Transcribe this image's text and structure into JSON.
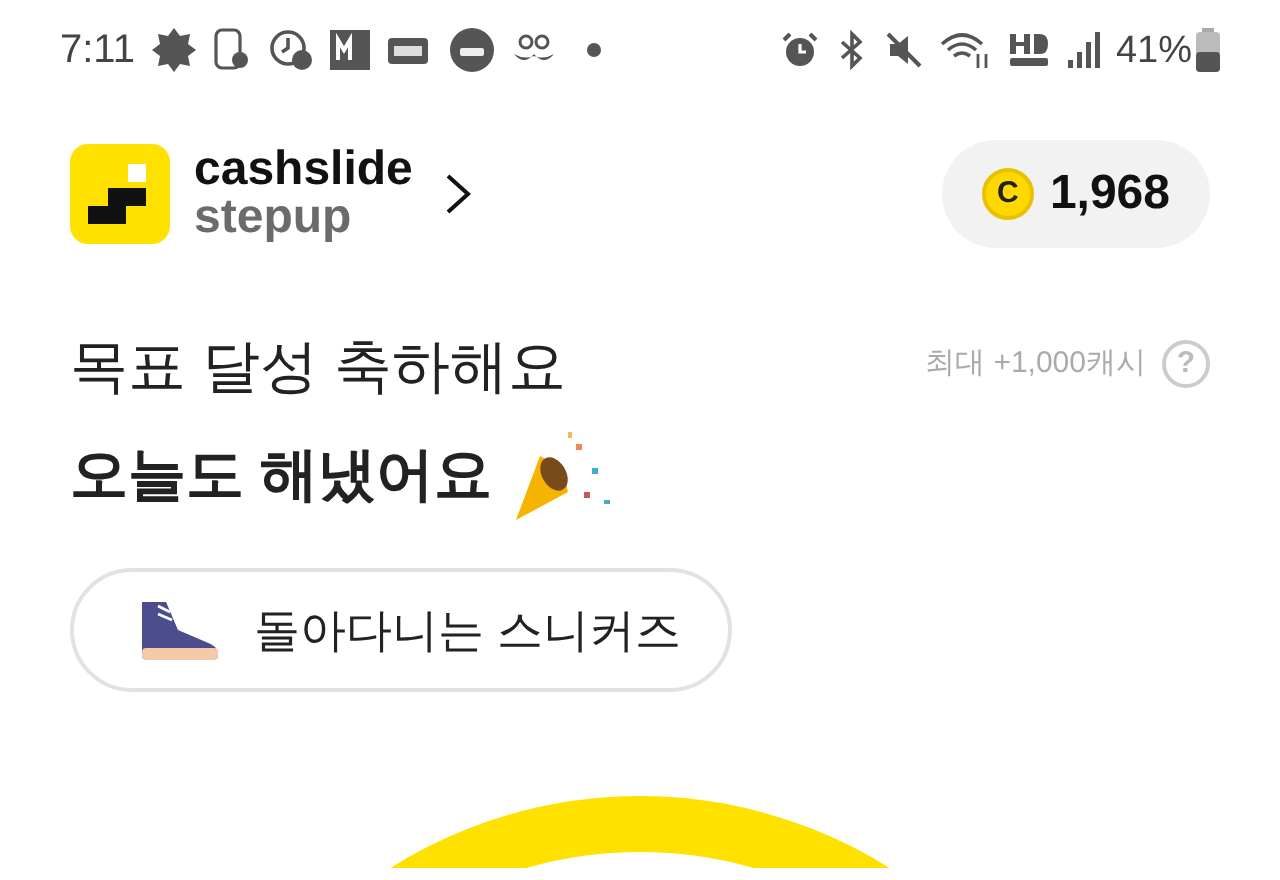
{
  "status_bar": {
    "time": "7:11",
    "battery": "41%"
  },
  "header": {
    "brand_top": "cashslide",
    "brand_bottom": "stepup",
    "coin_symbol": "C",
    "coins": "1,968"
  },
  "goal": {
    "title": "목표 달성 축하해요",
    "headline": "오늘도 해냈어요",
    "reward_note": "최대 +1,000캐시",
    "help_symbol": "?"
  },
  "item_chip": {
    "label": "돌아다니는 스니커즈"
  }
}
